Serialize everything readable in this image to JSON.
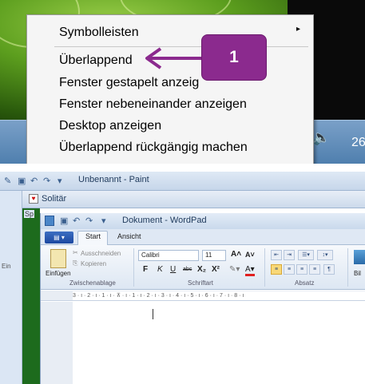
{
  "taskbar_menu": {
    "items": [
      {
        "label": "Symbolleisten",
        "has_submenu": true
      },
      {
        "label": "Überlappend"
      },
      {
        "label": "Fenster gestapelt anzeig"
      },
      {
        "label": "Fenster nebeneinander anzeigen"
      },
      {
        "label": "Desktop anzeigen"
      },
      {
        "label": "Überlappend rückgängig machen"
      }
    ],
    "submenu_arrow": "▸"
  },
  "callout": {
    "number": "1",
    "color": "#8b2a8e"
  },
  "tray": {
    "clock_partial": "26",
    "volume_glyph": "🔈"
  },
  "paint_window": {
    "title": "Unbenannt - Paint",
    "left_text": "Ein"
  },
  "solitaire_window": {
    "title": "Solitär",
    "left_fragment": "Sp"
  },
  "wordpad": {
    "title": "Dokument - WordPad",
    "tabs": {
      "start": "Start",
      "view": "Ansicht"
    },
    "clipboard": {
      "paste": "Einfügen",
      "cut": "Ausschneiden",
      "copy": "Kopieren",
      "group": "Zwischenablage"
    },
    "font": {
      "family": "Calibri",
      "size": "11",
      "grow": "A˄",
      "shrink": "A˅",
      "bold": "F",
      "italic": "K",
      "underline": "U",
      "strike": "abc",
      "sub": "X₂",
      "super": "X²",
      "group": "Schriftart"
    },
    "paragraph": {
      "group": "Absatz"
    },
    "picture": {
      "label": "Bil"
    },
    "ruler": "3 · ı · 2 · ı · 1 · ı · ⊼ · ı · 1 · ı · 2 · ı · 3 · ı · 4 · ı · 5 · ı · 6 · ı · 7 · ı · 8 · ı"
  }
}
